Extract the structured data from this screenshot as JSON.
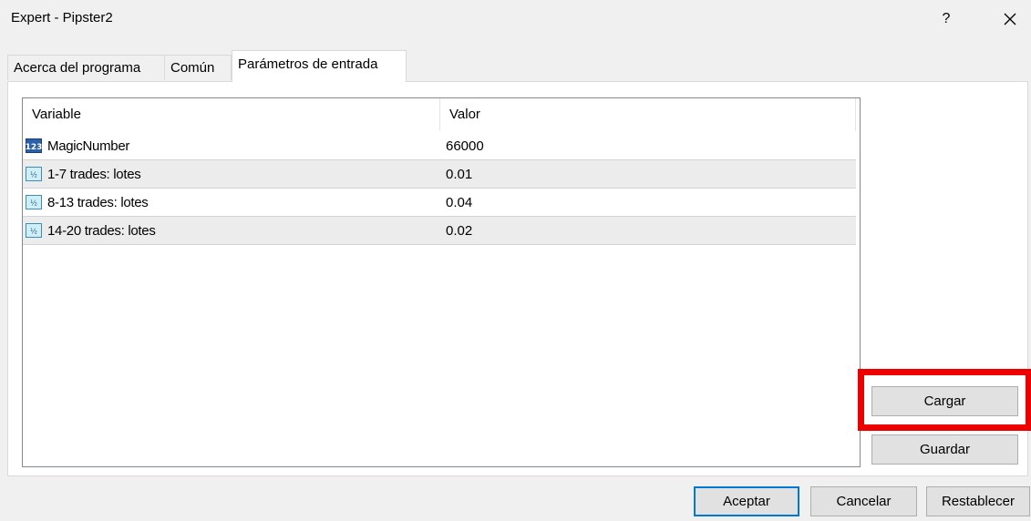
{
  "window": {
    "title": "Expert - Pipster2",
    "help_label": "?",
    "close_icon": "close-icon"
  },
  "tabs": [
    {
      "label": "Acerca del programa",
      "active": false
    },
    {
      "label": "Común",
      "active": false
    },
    {
      "label": "Parámetros de entrada",
      "active": true
    }
  ],
  "grid": {
    "columns": [
      "Variable",
      "Valor"
    ],
    "rows": [
      {
        "icon": "integer-type-icon",
        "variable": "MagicNumber",
        "value": "66000"
      },
      {
        "icon": "double-type-icon",
        "variable": "1-7 trades: lotes",
        "value": "0.01"
      },
      {
        "icon": "double-type-icon",
        "variable": "8-13 trades: lotes",
        "value": "0.04"
      },
      {
        "icon": "double-type-icon",
        "variable": "14-20 trades: lotes",
        "value": "0.02"
      }
    ]
  },
  "side_buttons": {
    "load_label": "Cargar",
    "save_label": "Guardar"
  },
  "footer": {
    "ok_label": "Aceptar",
    "cancel_label": "Cancelar",
    "reset_label": "Restablecer"
  },
  "colors": {
    "highlight": "#ee0000",
    "default_button_border": "#0078d7"
  }
}
